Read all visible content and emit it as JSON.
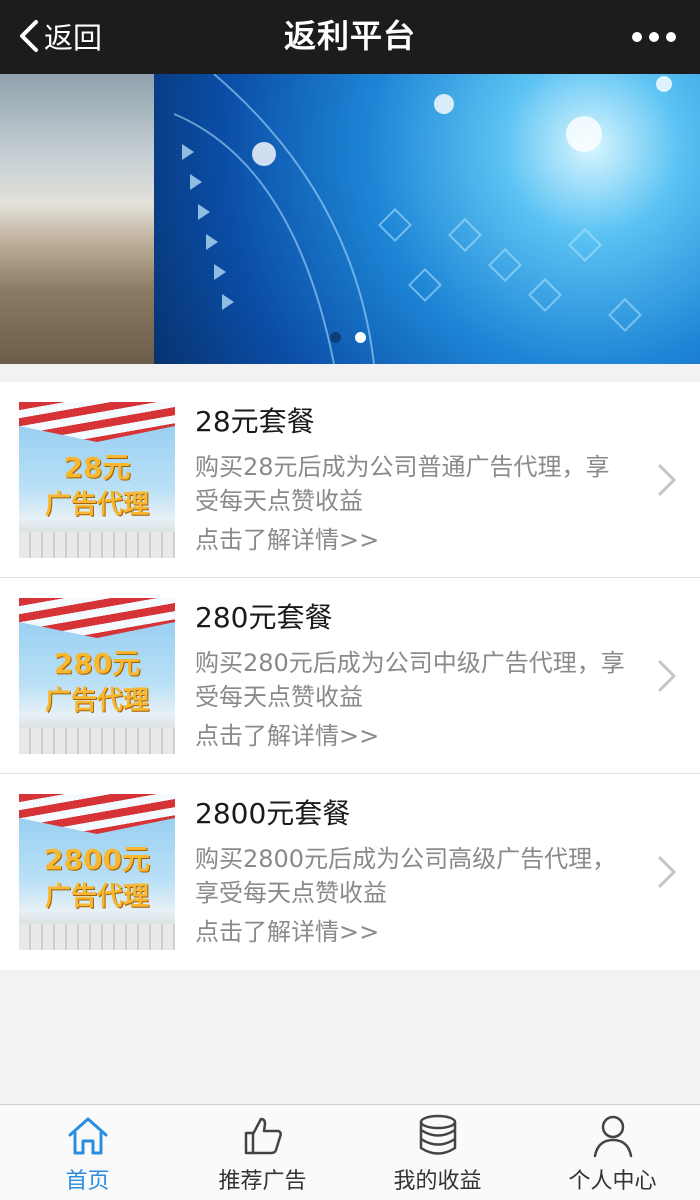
{
  "header": {
    "back_label": "返回",
    "title": "返利平台"
  },
  "banner": {
    "slide_count": 2,
    "active_slide": 2
  },
  "packages": [
    {
      "thumb_price": "28元",
      "thumb_label": "广告代理",
      "title": "28元套餐",
      "description": "购买28元后成为公司普通广告代理，享受每天点赞收益",
      "more": "点击了解详情>>"
    },
    {
      "thumb_price": "280元",
      "thumb_label": "广告代理",
      "title": "280元套餐",
      "description": "购买280元后成为公司中级广告代理，享受每天点赞收益",
      "more": "点击了解详情>>"
    },
    {
      "thumb_price": "2800元",
      "thumb_label": "广告代理",
      "title": "2800元套餐",
      "description": "购买2800元后成为公司高级广告代理，享受每天点赞收益",
      "more": "点击了解详情>>"
    }
  ],
  "tabbar": {
    "items": [
      {
        "label": "首页",
        "icon": "home-icon",
        "active": true
      },
      {
        "label": "推荐广告",
        "icon": "thumbs-up-icon",
        "active": false
      },
      {
        "label": "我的收益",
        "icon": "coins-stack-icon",
        "active": false
      },
      {
        "label": "个人中心",
        "icon": "user-icon",
        "active": false
      }
    ]
  },
  "colors": {
    "header_bg": "#1c1c1e",
    "accent": "#2a8ee0",
    "muted_text": "#8a8a8a"
  }
}
